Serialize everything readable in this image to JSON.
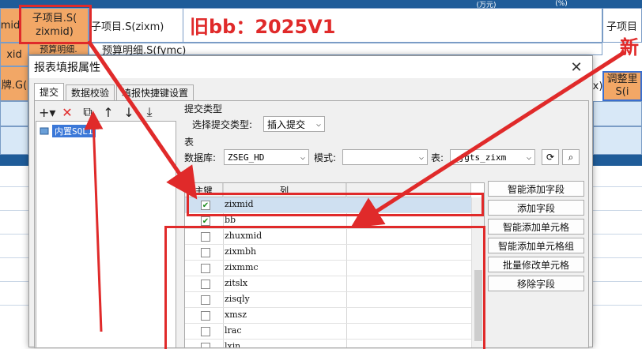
{
  "sheet": {
    "header_cells": {
      "top_left_pct1": "(万元)",
      "top_left_pct2": "(%)",
      "c1": "mid",
      "c2_line1": "子项目.S(",
      "c2_line2": "zixmid)",
      "c3": "子项目.S(zixm)",
      "c_right": "子项目",
      "r2_left": "xid",
      "r2_mid": "预算明细.S(fymc)",
      "r2_small": "预算明细.",
      "r3_left": "牌.G(",
      "r3_right_a": "调整里",
      "r3_right_b": "S(i",
      "r3_x": "x)"
    },
    "annotations": {
      "old": "旧bb：2025V1",
      "new": "新"
    }
  },
  "dialog": {
    "title": "报表填报属性",
    "close": "✕",
    "tabs": [
      "提交",
      "数据校验",
      "填报快捷键设置"
    ],
    "toolbar_icons": [
      "plus-icon",
      "delete-icon",
      "copy-icon",
      "arrow-up-icon",
      "arrow-down-icon",
      "arrow-bottom-icon"
    ],
    "toolbar_glyphs": [
      "+▾",
      "✕",
      "⧉",
      "↑",
      "↓",
      "⤓"
    ],
    "tree_item": "内置SQL1",
    "submit_type_section": "提交类型",
    "submit_type_label": "选择提交类型:",
    "submit_type_value": "插入提交",
    "table_section": "表",
    "db_label": "数据库:",
    "db_value": "ZSEG_HD",
    "mode_label": "模式:",
    "mode_value": "",
    "table_label": "表:",
    "table_value": "_jgts_zixm",
    "columns_section": "列",
    "col_headers": [
      "主键",
      "列",
      ""
    ],
    "rows": [
      {
        "name": "zixmid",
        "checked": true
      },
      {
        "name": "bb",
        "checked": true
      },
      {
        "name": "zhuxmid",
        "checked": false
      },
      {
        "name": "zixmbh",
        "checked": false
      },
      {
        "name": "zixmmc",
        "checked": false
      },
      {
        "name": "zitslx",
        "checked": false
      },
      {
        "name": "zisqly",
        "checked": false
      },
      {
        "name": "xmsz",
        "checked": false
      },
      {
        "name": "lrac",
        "checked": false
      },
      {
        "name": "lxjn",
        "checked": false
      }
    ],
    "side_buttons": [
      "智能添加字段",
      "添加字段",
      "智能添加单元格",
      "智能添加单元格组",
      "批量修改单元格",
      "移除字段"
    ]
  }
}
